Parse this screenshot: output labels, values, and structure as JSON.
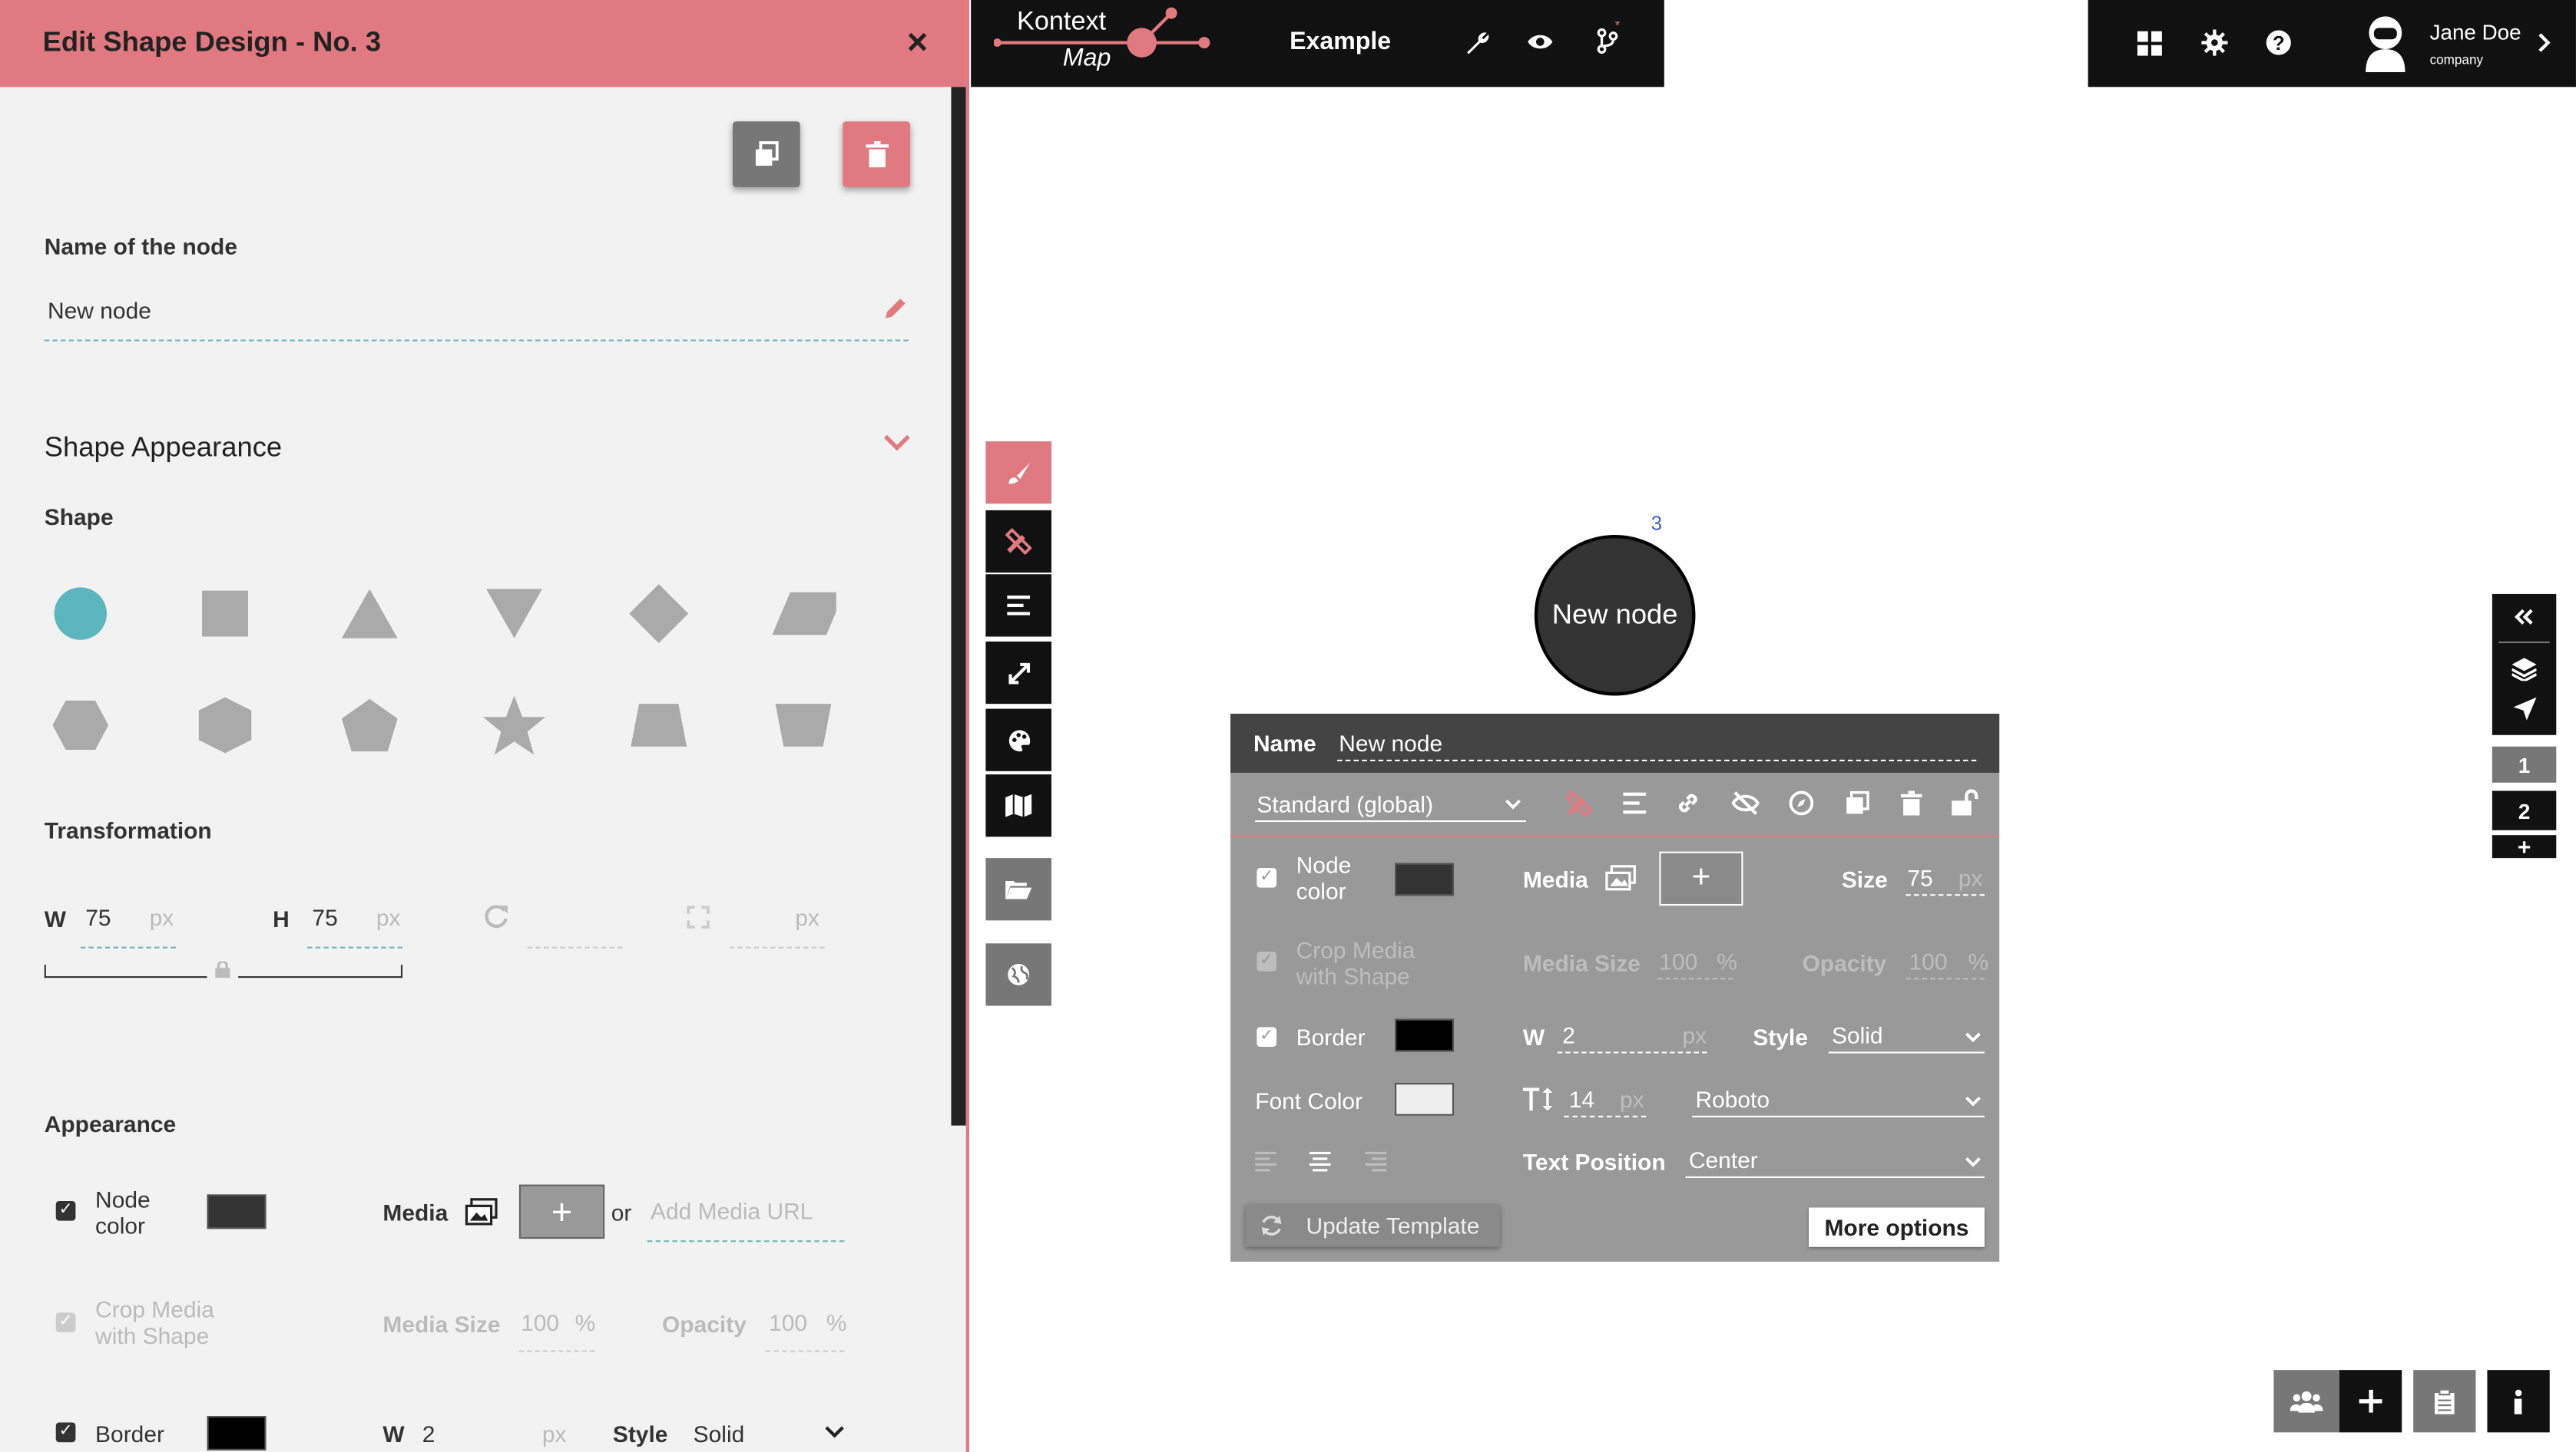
{
  "editor": {
    "title": "Edit Shape Design - No. 3",
    "close_glyph": "×",
    "name_label": "Name of the node",
    "name_value": "New node",
    "shape_appearance": "Shape Appearance",
    "shape_label": "Shape",
    "transformation_label": "Transformation",
    "w_label": "W",
    "w_value": "75",
    "h_label": "H",
    "h_value": "75",
    "px": "px",
    "appearance_label": "Appearance",
    "node_color_label": "Node color",
    "media_label": "Media",
    "or_label": "or",
    "media_url_placeholder": "Add Media URL",
    "crop_media_label": "Crop Media with Shape",
    "media_size_label": "Media Size",
    "media_size_value": "100",
    "opacity_label": "Opacity",
    "opacity_value": "100",
    "percent": "%",
    "border_label": "Border",
    "border_w_label": "W",
    "border_w_value": "2",
    "style_label": "Style",
    "style_value": "Solid",
    "colors": {
      "accent": "#e07a80",
      "selected_shape": "#5bb6bd",
      "shape": "#aaaaaa",
      "node_color": "#333333",
      "border_color": "#000000"
    }
  },
  "topbar": {
    "logo_top": "Kontext",
    "logo_bottom": "Map",
    "map_name": "Example",
    "user_name": "Jane Doe",
    "user_company": "company"
  },
  "canvas": {
    "node_label": "New node",
    "node_number": "3"
  },
  "popup": {
    "name_label": "Name",
    "name_value": "New node",
    "template_value": "Standard (global)",
    "node_color_label": "Node color",
    "media_label": "Media",
    "size_label": "Size",
    "size_value": "75",
    "px": "px",
    "crop_media_label": "Crop Media with Shape",
    "media_size_label": "Media Size",
    "media_size_value": "100",
    "opacity_label": "Opacity",
    "opacity_value": "100",
    "percent": "%",
    "border_label": "Border",
    "border_w_label": "W",
    "border_w_value": "2",
    "style_label": "Style",
    "style_value": "Solid",
    "font_color_label": "Font Color",
    "font_size_value": "14",
    "font_value": "Roboto",
    "text_position_label": "Text Position",
    "text_position_value": "Center",
    "update_template": "Update Template",
    "more_options": "More options"
  },
  "right_panel": {
    "layer_1": "1",
    "layer_2": "2",
    "add_layer": "+"
  }
}
